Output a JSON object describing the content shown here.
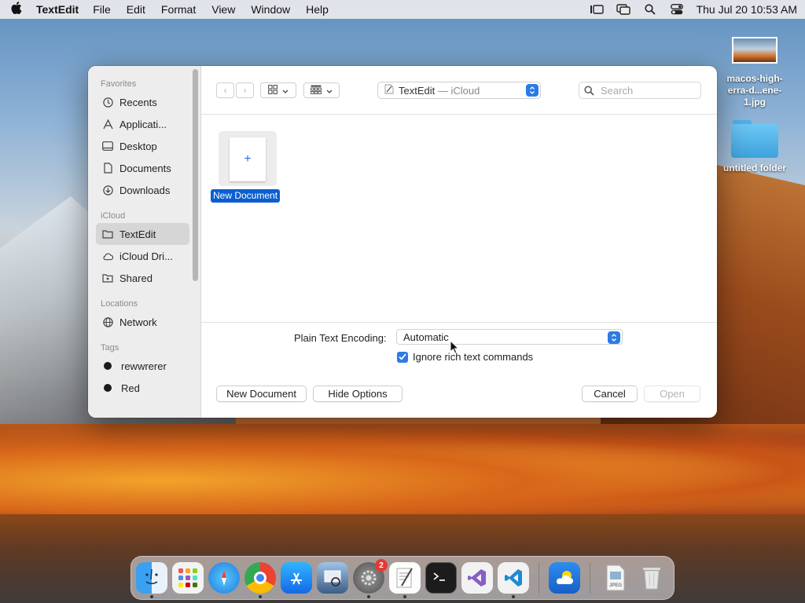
{
  "menubar": {
    "app_name": "TextEdit",
    "menus": [
      "File",
      "Edit",
      "Format",
      "View",
      "Window",
      "Help"
    ],
    "clock": "Thu Jul 20  10:53 AM"
  },
  "desktop": {
    "image_file_label": "macos-high-\nerra-d...ene-1.jpg",
    "folder_label": "untitled folder"
  },
  "dialog": {
    "sidebar": {
      "favorites_header": "Favorites",
      "favorites": [
        {
          "label": "Recents",
          "icon": "clock-icon"
        },
        {
          "label": "Applicati...",
          "icon": "applications-icon"
        },
        {
          "label": "Desktop",
          "icon": "desktop-icon"
        },
        {
          "label": "Documents",
          "icon": "document-icon"
        },
        {
          "label": "Downloads",
          "icon": "download-icon"
        }
      ],
      "icloud_header": "iCloud",
      "icloud": [
        {
          "label": "TextEdit",
          "icon": "folder-icon",
          "selected": true
        },
        {
          "label": "iCloud Dri...",
          "icon": "cloud-icon"
        },
        {
          "label": "Shared",
          "icon": "shared-folder-icon"
        }
      ],
      "locations_header": "Locations",
      "locations": [
        {
          "label": "Network",
          "icon": "globe-icon"
        }
      ],
      "tags_header": "Tags",
      "tags": [
        {
          "label": "rewwrerer",
          "color": "#1a1a1a"
        },
        {
          "label": "Red",
          "color": "#1a1a1a"
        }
      ]
    },
    "toolbar": {
      "location_app": "TextEdit",
      "location_sep": " — ",
      "location_place": "iCloud",
      "search_placeholder": "Search"
    },
    "files": [
      {
        "label": "New Document",
        "symbol": "+"
      }
    ],
    "options": {
      "encoding_label": "Plain Text Encoding:",
      "encoding_value": "Automatic",
      "ignore_rich_text_label": "Ignore rich text commands",
      "ignore_rich_text_checked": true
    },
    "buttons": {
      "new_document": "New Document",
      "hide_options": "Hide Options",
      "cancel": "Cancel",
      "open": "Open"
    }
  },
  "dock": {
    "settings_badge": "2"
  },
  "colors": {
    "accent": "#2c7be5",
    "selection": "#0a5fd1"
  }
}
